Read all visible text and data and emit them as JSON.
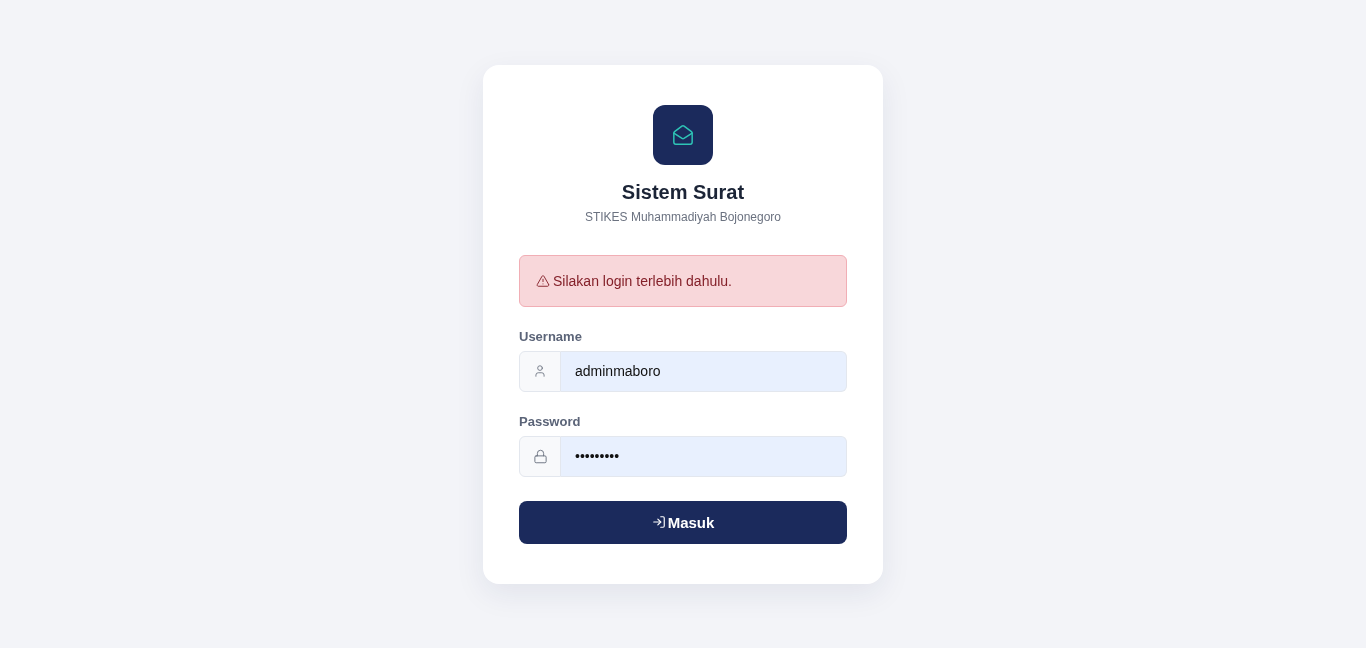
{
  "header": {
    "title": "Sistem Surat",
    "subtitle": "STIKES Muhammadiyah Bojonegoro"
  },
  "alert": {
    "kind": "warning",
    "message": "Silakan login terlebih dahulu."
  },
  "fields": [
    {
      "kind": "user",
      "label": "Username",
      "value": "adminmaboro",
      "autofilled": true
    },
    {
      "kind": "lock",
      "label": "Password",
      "value": "•••••••••",
      "autofilled": true
    }
  ],
  "submit": {
    "label": "Masuk"
  }
}
